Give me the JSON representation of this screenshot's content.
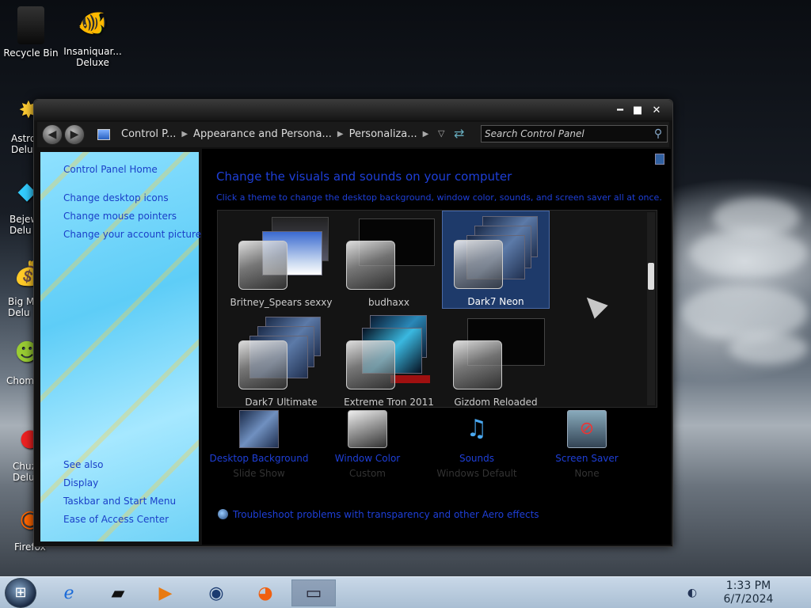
{
  "desktop": {
    "icons": [
      {
        "label": "Recycle Bin",
        "icon": "recycle-bin-icon"
      },
      {
        "label": "Insaniquar... Deluxe",
        "icon": "goldfish-icon"
      },
      {
        "label": "Astro Delu",
        "icon": "astro-icon"
      },
      {
        "label": "Bejew Delu",
        "icon": "gem-icon"
      },
      {
        "label": "Big M Delu",
        "icon": "money-bag-icon"
      },
      {
        "label": "Chom",
        "icon": "chomp-icon"
      },
      {
        "label": "Chuz Delu",
        "icon": "chuzzle-icon"
      },
      {
        "label": "Firefox",
        "icon": "firefox-icon"
      }
    ]
  },
  "window": {
    "breadcrumbs": [
      "Control P...",
      "Appearance and Persona...",
      "Personaliza..."
    ],
    "search_placeholder": "Search Control Panel",
    "buttons": {
      "minimize": "━",
      "maximize": "■",
      "close": "✕"
    }
  },
  "left_pane": {
    "home": "Control Panel Home",
    "links": [
      "Change desktop icons",
      "Change mouse pointers",
      "Change your account picture"
    ],
    "see_also_title": "See also",
    "see_also": [
      "Display",
      "Taskbar and Start Menu",
      "Ease of Access Center"
    ]
  },
  "main": {
    "title": "Change the visuals and sounds on your computer",
    "subtitle": "Click a theme to change the desktop background, window color, sounds, and screen saver all at once.",
    "themes": [
      {
        "name": "Britney_Spears sexxy",
        "selected": false
      },
      {
        "name": "budhaxx",
        "selected": false
      },
      {
        "name": "Dark7 Neon",
        "selected": true
      },
      {
        "name": "Dark7 Ultimate",
        "selected": false
      },
      {
        "name": "Extreme Tron 2011",
        "selected": false
      },
      {
        "name": "Gizdom Reloaded",
        "selected": false
      }
    ],
    "settings": [
      {
        "title": "Desktop Background",
        "value": "Slide Show",
        "icon": "desktop-background-icon"
      },
      {
        "title": "Window Color",
        "value": "Custom",
        "icon": "window-color-icon"
      },
      {
        "title": "Sounds",
        "value": "Windows Default",
        "icon": "sounds-icon"
      },
      {
        "title": "Screen Saver",
        "value": "None",
        "icon": "screen-saver-icon"
      }
    ],
    "troubleshoot": "Troubleshoot problems with transparency and other Aero effects"
  },
  "taskbar": {
    "time": "1:33 PM",
    "date": "6/7/2024"
  },
  "colors": {
    "link": "#1e3fd8",
    "selected_theme": "#1e3a6a"
  }
}
